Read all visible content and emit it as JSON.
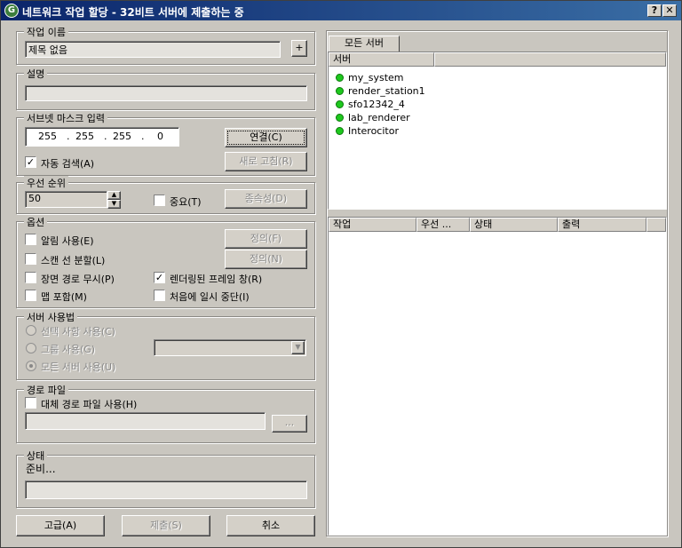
{
  "window": {
    "title": "네트워크 작업 할당 - 32비트 서버에 제출하는 중",
    "help_label": "?",
    "close_label": "✕"
  },
  "job_name": {
    "label": "작업 이름",
    "value": "제목 없음",
    "plus_label": "+"
  },
  "description": {
    "label": "설명",
    "value": ""
  },
  "subnet": {
    "label": "서브넷 마스크 입력",
    "octets": [
      "255",
      "255",
      "255",
      "0"
    ],
    "connect_label": "연결(C)",
    "refresh_label": "새로 고침(R)",
    "auto_search_label": "자동 검색(A)",
    "auto_search_checked": true
  },
  "priority": {
    "label": "우선 순위",
    "value": "50",
    "critical_label": "중요(T)",
    "critical_checked": false,
    "dependencies_label": "종속성(D)"
  },
  "options": {
    "label": "옵션",
    "notify_label": "알림 사용(E)",
    "notify_checked": false,
    "define_label_1": "정의(F)",
    "split_scan_label": "스캔 선 분할(L)",
    "split_scan_checked": false,
    "define_label_2": "정의(N)",
    "ignore_scene_path_label": "장면 경로 무시(P)",
    "ignore_scene_path_checked": false,
    "rendered_frame_label": "렌더링된 프레임 창(R)",
    "rendered_frame_checked": true,
    "include_maps_label": "맵 포함(M)",
    "include_maps_checked": false,
    "initially_suspend_label": "처음에 일시 중단(I)",
    "initially_suspend_checked": false
  },
  "server_usage": {
    "label": "서버 사용법",
    "selected_label": "선택 사항 사용(C)",
    "group_label": "그룹 사용(G)",
    "all_label": "모든 서버 사용(U)",
    "selected": "all"
  },
  "path_file": {
    "label": "경로 파일",
    "alt_path_label": "대체 경로 파일 사용(H)",
    "alt_path_checked": false,
    "value": "",
    "browse_label": "..."
  },
  "status": {
    "label": "상태",
    "text": "준비..."
  },
  "buttons": {
    "advanced": "고급(A)",
    "submit": "제출(S)",
    "cancel": "취소"
  },
  "servers": {
    "tab": "모든 서버",
    "header": "서버",
    "status_color": "#1ec81e",
    "items": [
      "my_system",
      "render_station1",
      "sfo12342_4",
      "lab_renderer",
      "Interocitor"
    ]
  },
  "jobs": {
    "columns": [
      "작업",
      "우선 ...",
      "상태",
      "출력"
    ]
  }
}
